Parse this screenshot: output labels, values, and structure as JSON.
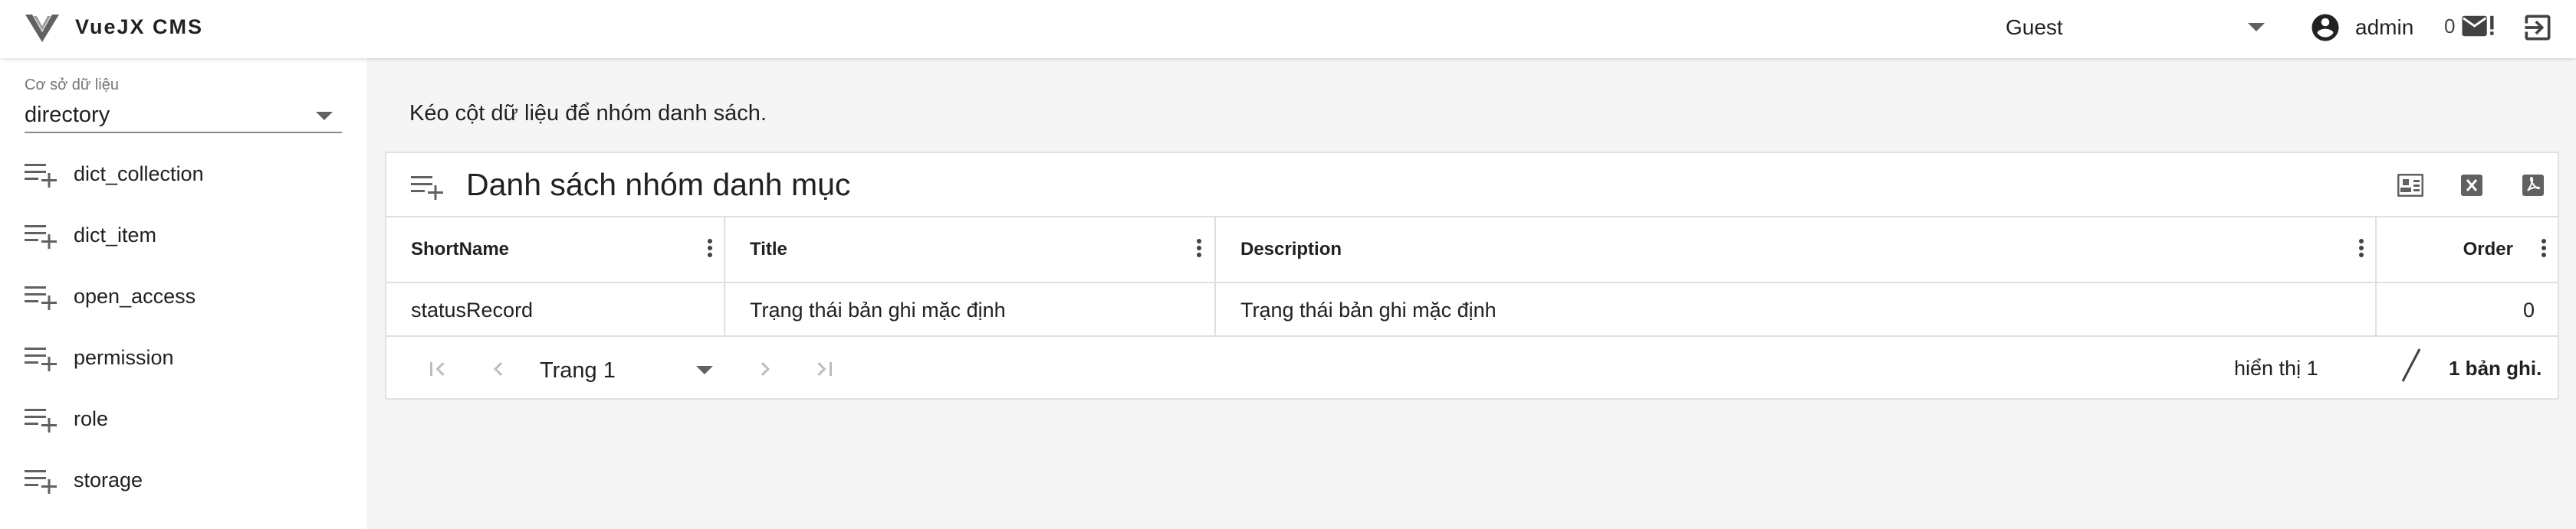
{
  "header": {
    "app_title": "VueJX CMS",
    "logo_icon": "vuejx-logo-icon",
    "role": "Guest",
    "user_name": "admin",
    "mail_count": "0",
    "icons": [
      "account-circle-icon",
      "mail-alert-icon",
      "logout-icon"
    ]
  },
  "sidebar": {
    "db_label": "Cơ sở dữ liệu",
    "db_value": "directory",
    "items": [
      {
        "label": "dict_collection",
        "icon": "playlist-add-icon"
      },
      {
        "label": "dict_item",
        "icon": "playlist-add-icon"
      },
      {
        "label": "open_access",
        "icon": "playlist-add-icon"
      },
      {
        "label": "permission",
        "icon": "playlist-add-icon"
      },
      {
        "label": "role",
        "icon": "playlist-add-icon"
      },
      {
        "label": "storage",
        "icon": "playlist-add-icon"
      }
    ]
  },
  "main": {
    "hint": "Kéo cột dữ liệu để nhóm danh sách.",
    "panel_title": "Danh sách nhóm danh mục",
    "toolbar_icons": [
      "column-settings-icon",
      "excel-export-icon",
      "pdf-export-icon"
    ],
    "columns": [
      "ShortName",
      "Title",
      "Description",
      "Order"
    ],
    "rows": [
      {
        "shortname": "statusRecord",
        "title": "Trạng thái bản ghi mặc định",
        "description": "Trạng thái bản ghi mặc định",
        "order": "0"
      }
    ],
    "pager": {
      "page": "Trang 1",
      "showing": "hiển thị 1",
      "separator": "/",
      "total": "1 bản ghi."
    }
  },
  "colors": {
    "background": "#f5f5f5",
    "surface": "#ffffff",
    "border": "#e0e0e0",
    "text": "#212121",
    "icon": "#616161"
  }
}
